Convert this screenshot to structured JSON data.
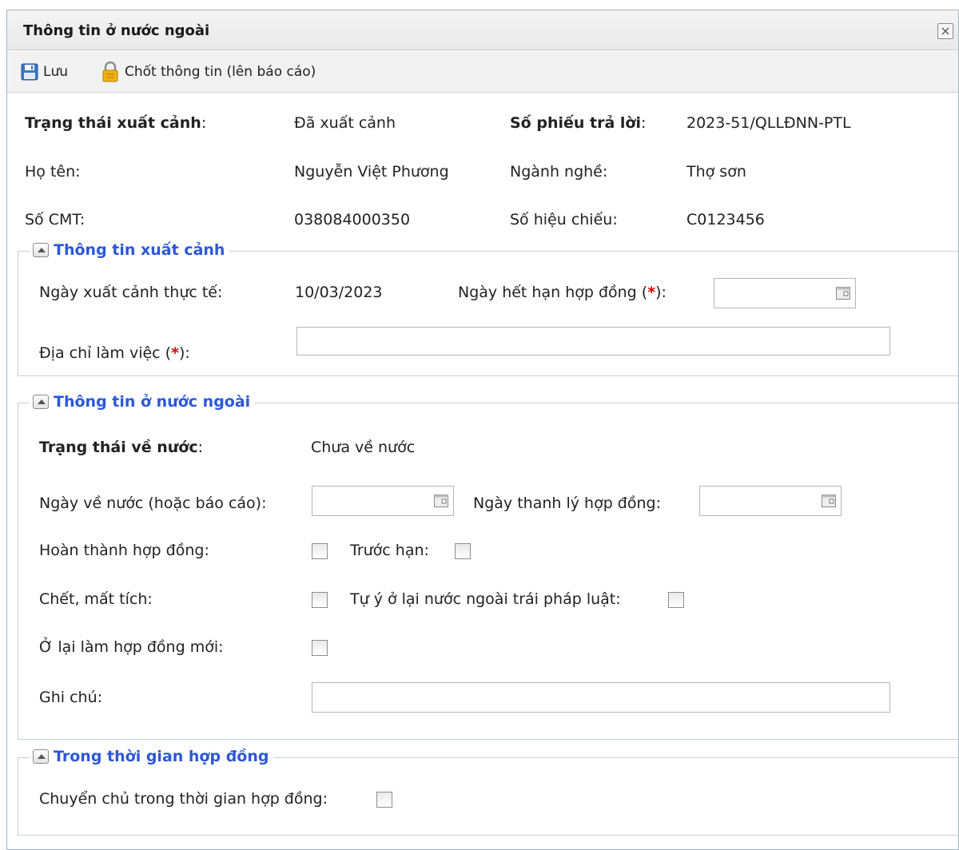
{
  "window": {
    "title": "Thông tin ở nước ngoài"
  },
  "toolbar": {
    "save_label": "Lưu",
    "lock_label": "Chốt thông tin (lên báo cáo)"
  },
  "summary": {
    "exit_status_label": "Trạng thái xuất cảnh",
    "exit_status_value": "Đã xuất cảnh",
    "reply_no_label": "Số phiếu trả lời",
    "reply_no_value": "2023-51/QLLĐNN-PTL",
    "name_label": "Họ tên:",
    "name_value": "Nguyễn Việt Phương",
    "occupation_label": "Ngành nghề:",
    "occupation_value": "Thợ sơn",
    "id_label": "Số CMT:",
    "id_value": "038084000350",
    "passport_label": "Số hiệu chiếu:",
    "passport_value": "C0123456"
  },
  "exit_info": {
    "legend": "Thông tin xuất cảnh",
    "actual_exit_label": "Ngày xuất cảnh thực tế:",
    "actual_exit_value": "10/03/2023",
    "contract_expiry_label": "Ngày hết hạn hợp đồng (",
    "workplace_label": "Địa chỉ làm việc (",
    "required_mark": "*",
    "label_suffix": "):",
    "contract_expiry_value": "",
    "workplace_value": ""
  },
  "abroad_info": {
    "legend": "Thông tin ở nước ngoài",
    "return_status_label": "Trạng thái về nước",
    "return_status_value": "Chưa về nước",
    "return_date_label": "Ngày về nước (hoặc báo cáo):",
    "liquidation_label": "Ngày thanh lý hợp đồng:",
    "completed_label": "Hoàn thành hợp đồng:",
    "early_label": "Trước hạn:",
    "dead_missing_label": "Chết, mất tích:",
    "illegal_stay_label": "Tự ý ở lại nước ngoài trái pháp luật:",
    "new_contract_label": "Ở lại làm hợp đồng mới:",
    "note_label": "Ghi chú:",
    "note_value": ""
  },
  "contract_period": {
    "legend": "Trong thời gian hợp đồng",
    "transfer_label": "Chuyển chủ trong thời gian hợp đồng:"
  },
  "colors": {
    "legend": "#2b58d9",
    "required": "#e00000"
  }
}
